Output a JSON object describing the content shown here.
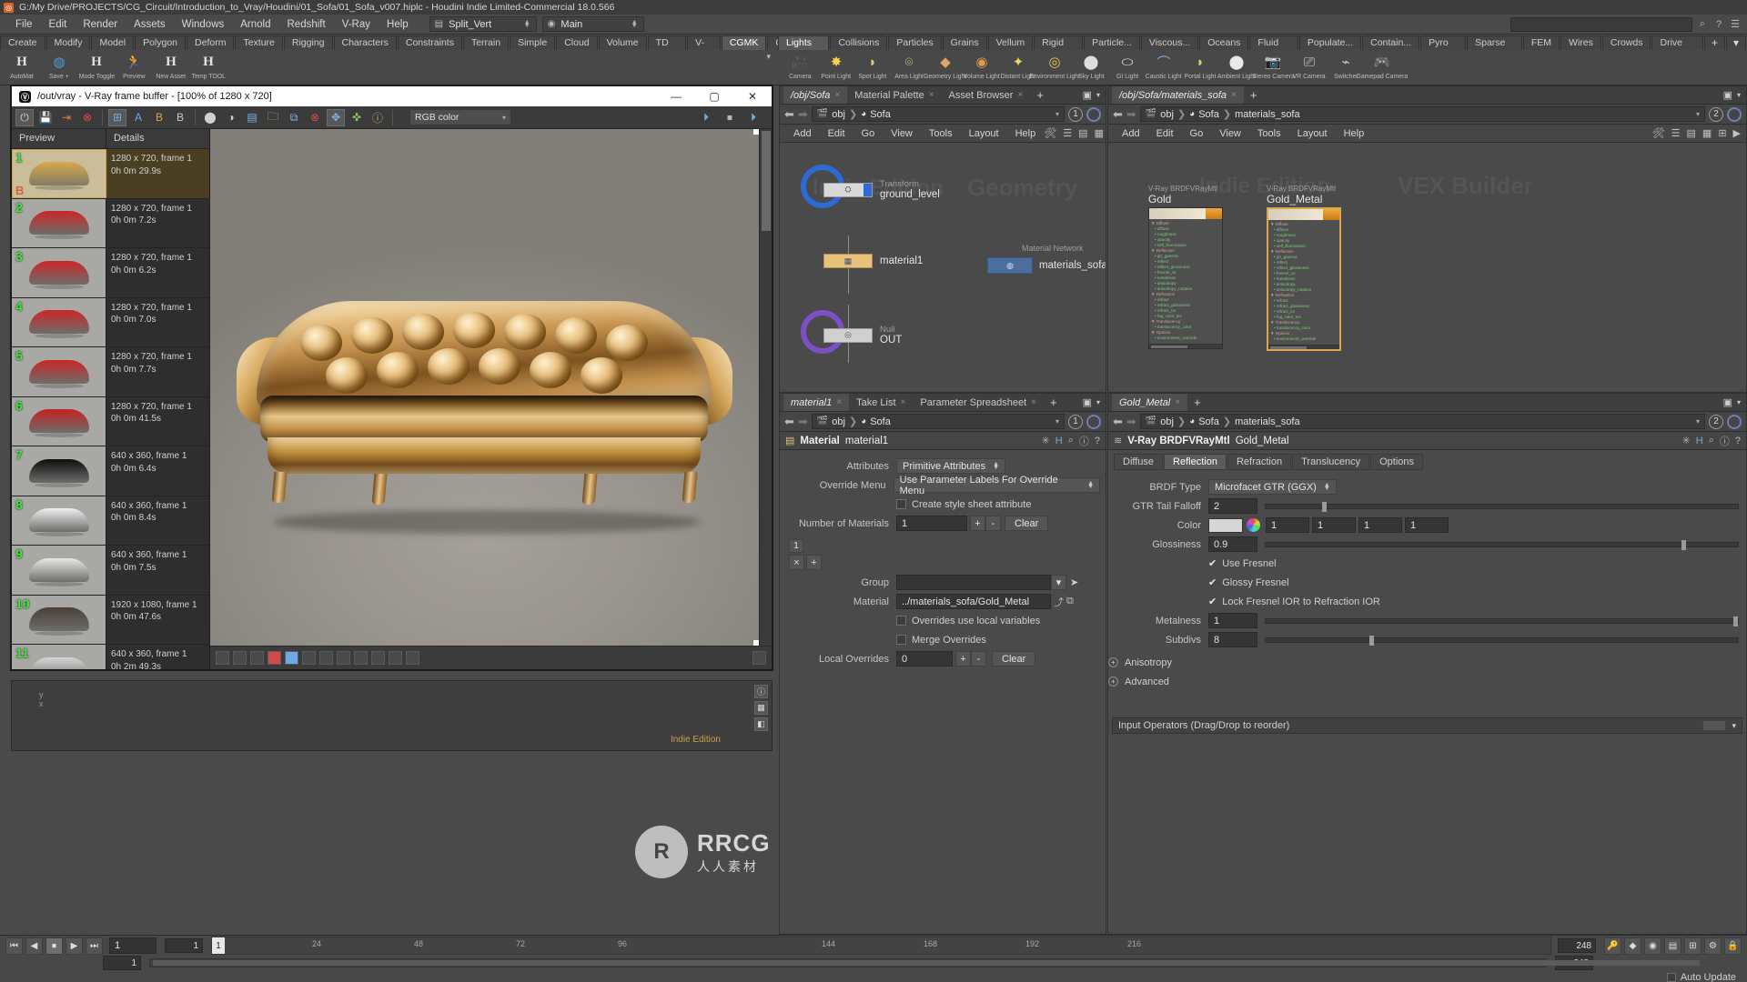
{
  "window": {
    "title": "G:/My Drive/PROJECTS/CG_Circuit/Introduction_to_Vray/Houdini/01_Sofa/01_Sofa_v007.hiplc - Houdini Indie Limited-Commercial 18.0.566",
    "logo_icon": "houdini-logo-icon"
  },
  "menubar": {
    "items": [
      "File",
      "Edit",
      "Render",
      "Assets",
      "Windows",
      "Arnold",
      "Redshift",
      "V-Ray",
      "Help"
    ],
    "desktop": {
      "icon": "split-layout-icon",
      "label": "Split_Vert"
    },
    "viewport_set": {
      "icon": "target-icon",
      "label": "Main"
    },
    "right_icons": [
      "search-icon",
      "help-icon",
      "menu-icon"
    ]
  },
  "shelf": {
    "left_tabs": [
      "Create",
      "Modify",
      "Model",
      "Polygon",
      "Deform",
      "Texture",
      "Rigging",
      "Characters",
      "Constraints",
      "Terrain FX",
      "Simple FX",
      "Cloud FX",
      "Volume",
      "TD Tools",
      "V-Ray",
      "CGMK",
      "CGMK_Rig"
    ],
    "left_active": "CGMK",
    "add_label": "+",
    "left_tools": [
      {
        "icon": "h-icon",
        "label": "AutoMat"
      },
      {
        "icon": "save-icon",
        "label": "Save +"
      },
      {
        "icon": "h-icon",
        "label": "Mode Toggle"
      },
      {
        "icon": "runner-icon",
        "label": "Preview"
      },
      {
        "icon": "h-icon",
        "label": "New Asset"
      },
      {
        "icon": "h-icon",
        "label": "Temp TOOL"
      }
    ],
    "right_tabs": [
      "Lights a...",
      "Collisions",
      "Particles",
      "Grains",
      "Vellum",
      "Rigid B...",
      "Particle...",
      "Viscous...",
      "Oceans",
      "Fluid C...",
      "Populate...",
      "Contain...",
      "Pyro FX",
      "Sparse P...",
      "FEM",
      "Wires",
      "Crowds",
      "Drive Si..."
    ],
    "right_active": "Lights a...",
    "right_tools": [
      {
        "icon": "camera-icon",
        "label": "Camera"
      },
      {
        "icon": "point-light-icon",
        "label": "Point Light"
      },
      {
        "icon": "spot-light-icon",
        "label": "Spot Light"
      },
      {
        "icon": "area-light-icon",
        "label": "Area Light"
      },
      {
        "icon": "geometry-light-icon",
        "label": "Geometry Light"
      },
      {
        "icon": "volume-light-icon",
        "label": "Volume Light"
      },
      {
        "icon": "distant-light-icon",
        "label": "Distant Light"
      },
      {
        "icon": "environment-light-icon",
        "label": "Environment Light"
      },
      {
        "icon": "sky-light-icon",
        "label": "Sky Light"
      },
      {
        "icon": "gi-light-icon",
        "label": "GI Light"
      },
      {
        "icon": "caustic-light-icon",
        "label": "Caustic Light"
      },
      {
        "icon": "portal-light-icon",
        "label": "Portal Light"
      },
      {
        "icon": "ambient-light-icon",
        "label": "Ambient Light"
      },
      {
        "icon": "stereo-camera-icon",
        "label": "Stereo Camera"
      },
      {
        "icon": "vr-camera-icon",
        "label": "VR Camera"
      },
      {
        "icon": "switcher-icon",
        "label": "Switcher"
      },
      {
        "icon": "gamepad-camera-icon",
        "label": "Gamepad Camera"
      }
    ]
  },
  "vfb": {
    "title": "/out/vray - V-Ray frame buffer - [100% of 1280 x 720]",
    "logo_icon": "vray-logo-icon",
    "window_buttons": [
      "minimize-icon",
      "maximize-icon",
      "close-icon"
    ],
    "toolbar_icons": [
      "power-icon",
      "save-icon",
      "save-as-icon",
      "stop-render-icon",
      "ab-compare-icon",
      "a-buffer-icon",
      "b-buffer-icon",
      "clear-icon",
      "pixel-icon",
      "circle-icon",
      "half-circle-icon",
      "save-channel-icon",
      "folder-icon",
      "copy-icon",
      "remove-icon",
      "move-icon",
      "pan-icon",
      "info-icon"
    ],
    "color_mode": "RGB color",
    "render_icons": [
      "render-last-icon",
      "stop-icon",
      "render-icon"
    ],
    "list_headers": [
      "Preview",
      "Details"
    ],
    "history": [
      {
        "num": "1",
        "res": "1280 x 720, frame 1",
        "time": "0h 0m 29.9s",
        "color": "#d8a84e",
        "selected": true,
        "bookmark": "B"
      },
      {
        "num": "2",
        "res": "1280 x 720, frame 1",
        "time": "0h 0m 7.2s",
        "color": "#cc2626",
        "selected": false
      },
      {
        "num": "3",
        "res": "1280 x 720, frame 1",
        "time": "0h 0m 6.2s",
        "color": "#cc2626",
        "selected": false
      },
      {
        "num": "4",
        "res": "1280 x 720, frame 1",
        "time": "0h 0m 7.0s",
        "color": "#cc2626",
        "selected": false
      },
      {
        "num": "5",
        "res": "1280 x 720, frame 1",
        "time": "0h 0m 7.7s",
        "color": "#cc2626",
        "selected": false
      },
      {
        "num": "6",
        "res": "1280 x 720, frame 1",
        "time": "0h 0m 41.5s",
        "color": "#c42222",
        "selected": false
      },
      {
        "num": "7",
        "res": "640 x 360, frame 1",
        "time": "0h 0m 6.4s",
        "color": "#0d0d0d",
        "selected": false
      },
      {
        "num": "8",
        "res": "640 x 360, frame 1",
        "time": "0h 0m 8.4s",
        "color": "#efefef",
        "selected": false
      },
      {
        "num": "9",
        "res": "640 x 360, frame 1",
        "time": "0h 0m 7.5s",
        "color": "#e8e8e8",
        "selected": false
      },
      {
        "num": "10",
        "res": "1920 x 1080, frame 1",
        "time": "0h 0m 47.6s",
        "color": "#4a4038",
        "selected": false
      },
      {
        "num": "11",
        "res": "640 x 360, frame 1",
        "time": "0h 2m 49.3s",
        "color": "#d6d6d6",
        "selected": false
      }
    ],
    "watermark": "Indie Edition"
  },
  "network": {
    "tabs": [
      {
        "label": "/obj/Sofa",
        "active": true
      },
      {
        "label": "Material Palette",
        "active": false
      },
      {
        "label": "Asset Browser",
        "active": false
      }
    ],
    "add_tab": "+",
    "breadcrumb": [
      "obj",
      "Sofa"
    ],
    "pane_index": "1",
    "menu": [
      "Add",
      "Edit",
      "Go",
      "View",
      "Tools",
      "Layout",
      "Help"
    ],
    "watermark_edition": "Indie Edition",
    "watermark_context": "Geometry",
    "nodes": [
      {
        "type": "Transform",
        "name": "ground_level",
        "ring_color": "#2d6ad6"
      },
      {
        "type": "",
        "name": "material1",
        "ring_color": ""
      },
      {
        "type": "Null",
        "name": "OUT",
        "ring_color": "#7d4fc7"
      }
    ],
    "material_node": {
      "label": "materials_sofa",
      "caption": "Material Network"
    }
  },
  "vexbuilder": {
    "tab": "/obj/Sofa/materials_sofa",
    "breadcrumb": [
      "obj",
      "Sofa",
      "materials_sofa"
    ],
    "pane_index": "2",
    "menu": [
      "Add",
      "Edit",
      "Go",
      "View",
      "Tools",
      "Layout",
      "Help"
    ],
    "watermark_edition": "Indie Edition",
    "watermark_context": "VEX Builder",
    "nodes": [
      {
        "type": "V-Ray BRDFVRayMtl",
        "name": "Gold",
        "brdf_tag": "brdf",
        "sections": [
          {
            "title": "Diffuse",
            "params": [
              "diffuse",
              "roughness",
              "opacity",
              "self_illumination"
            ]
          },
          {
            "title": "Reflection",
            "params": [
              "gtr_gamma",
              "reflect",
              "reflect_glossiness",
              "fresnel_ior",
              "metalness",
              "anisotropy",
              "anisotropy_rotation"
            ]
          },
          {
            "title": "Refraction",
            "params": [
              "refract",
              "refract_glossiness",
              "refract_ior",
              "fog_color_tex"
            ]
          },
          {
            "title": "Translucency",
            "params": [
              "translucency_color"
            ]
          },
          {
            "title": "Options",
            "params": [
              "environment_override"
            ]
          }
        ]
      },
      {
        "type": "V-Ray BRDFVRayMtl",
        "name": "Gold_Metal",
        "brdf_tag": "brdf",
        "sections": [
          {
            "title": "Diffuse",
            "params": [
              "diffuse",
              "roughness",
              "opacity",
              "self_illumination"
            ]
          },
          {
            "title": "Reflection",
            "params": [
              "gtr_gamma",
              "reflect",
              "reflect_glossiness",
              "fresnel_ior",
              "metalness",
              "anisotropy",
              "anisotropy_rotation"
            ]
          },
          {
            "title": "Refraction",
            "params": [
              "refract",
              "refract_glossiness",
              "refract_ior",
              "fog_color_tex"
            ]
          },
          {
            "title": "Translucency",
            "params": [
              "translucency_color"
            ]
          },
          {
            "title": "Options",
            "params": [
              "environment_override"
            ]
          }
        ]
      }
    ]
  },
  "parameters_center": {
    "tabs": [
      {
        "label": "material1",
        "active": true
      },
      {
        "label": "Take List",
        "active": false
      },
      {
        "label": "Parameter Spreadsheet",
        "active": false
      }
    ],
    "add_tab": "+",
    "breadcrumb": [
      "obj",
      "Sofa"
    ],
    "pane_index": "1",
    "op_type": "Material",
    "op_name": "material1",
    "header_icons": [
      "gear-icon",
      "h-icon",
      "search-icon",
      "info-icon",
      "help-icon"
    ],
    "rows": [
      {
        "label": "Attributes",
        "type": "menu",
        "value": "Primitive Attributes"
      },
      {
        "label": "Override Menu",
        "type": "menu",
        "value": "Use Parameter Labels For Override Menu"
      },
      {
        "label": "",
        "type": "checkbox",
        "value": "Create style sheet attribute",
        "checked": false
      },
      {
        "label": "Number of Materials",
        "type": "int",
        "value": "1",
        "buttons": [
          "+",
          "-"
        ],
        "clear": "Clear"
      }
    ],
    "multiparm_index": "1",
    "group_label": "Group",
    "group_value": "",
    "material_label": "Material",
    "material_value": "../materials_sofa/Gold_Metal",
    "checkbox_overrides": "Overrides use local variables",
    "checkbox_merge": "Merge Overrides",
    "local_overrides_label": "Local Overrides",
    "local_overrides_value": "0",
    "local_overrides_buttons": [
      "+",
      "-"
    ],
    "local_overrides_clear": "Clear"
  },
  "parameters_right": {
    "tab": "Gold_Metal",
    "breadcrumb": [
      "obj",
      "Sofa",
      "materials_sofa"
    ],
    "pane_index": "2",
    "op_type": "V-Ray BRDFVRayMtl",
    "op_name": "Gold_Metal",
    "header_icons": [
      "gear-icon",
      "h-icon",
      "search-icon",
      "info-icon",
      "help-icon"
    ],
    "tabs": [
      "Diffuse",
      "Reflection",
      "Refraction",
      "Translucency",
      "Options"
    ],
    "active_tab": "Reflection",
    "rows": [
      {
        "label": "BRDF Type",
        "type": "menu",
        "value": "Microfacet GTR (GGX)"
      },
      {
        "label": "GTR Tail Falloff",
        "type": "float",
        "value": "2",
        "slider": 0.12
      },
      {
        "label": "Color",
        "type": "color",
        "values": [
          "1",
          "1",
          "1",
          "1"
        ],
        "swatch": "#d6d6d6"
      },
      {
        "label": "Glossiness",
        "type": "float",
        "value": "0.9",
        "slider": 0.88
      },
      {
        "label": "",
        "type": "toggle",
        "value": "Use Fresnel",
        "checked": true
      },
      {
        "label": "",
        "type": "toggle",
        "value": "Glossy Fresnel",
        "checked": true
      },
      {
        "label": "",
        "type": "toggle",
        "value": "Lock Fresnel IOR to Refraction IOR",
        "checked": true
      },
      {
        "label": "Metalness",
        "type": "float",
        "value": "1",
        "slider": 1.0
      },
      {
        "label": "Subdivs",
        "type": "int",
        "value": "8",
        "slider": 0.22
      }
    ],
    "collapsed": [
      "Anisotropy",
      "Advanced"
    ],
    "input_operators": "Input Operators (Drag/Drop to reorder)"
  },
  "playbar": {
    "buttons": [
      "skip-start-icon",
      "step-back-icon",
      "stop-icon",
      "play-icon",
      "skip-end-icon"
    ],
    "current_frame": "1",
    "range_start": "1",
    "range_end": "248",
    "global_start": "1",
    "global_end": "248",
    "ticks": [
      "24",
      "48",
      "72",
      "96",
      "144",
      "168",
      "192",
      "216"
    ],
    "playhead": "1",
    "auto_update": "Auto Update",
    "right_icons": [
      "key-icon",
      "keyframe-icon",
      "scope-icon",
      "channel-icon",
      "snapshot-icon",
      "settings-icon",
      "lock-icon"
    ]
  },
  "watermark": {
    "initials": "R",
    "brand": "RRCG",
    "sub": "人人素材"
  },
  "colors": {
    "accent_blue": "#2d6ad6",
    "accent_purple": "#7d4fc7",
    "gold": "#d8a84e",
    "panel_bg": "#4a4a4a",
    "dark_bg": "#2e2e2e"
  }
}
